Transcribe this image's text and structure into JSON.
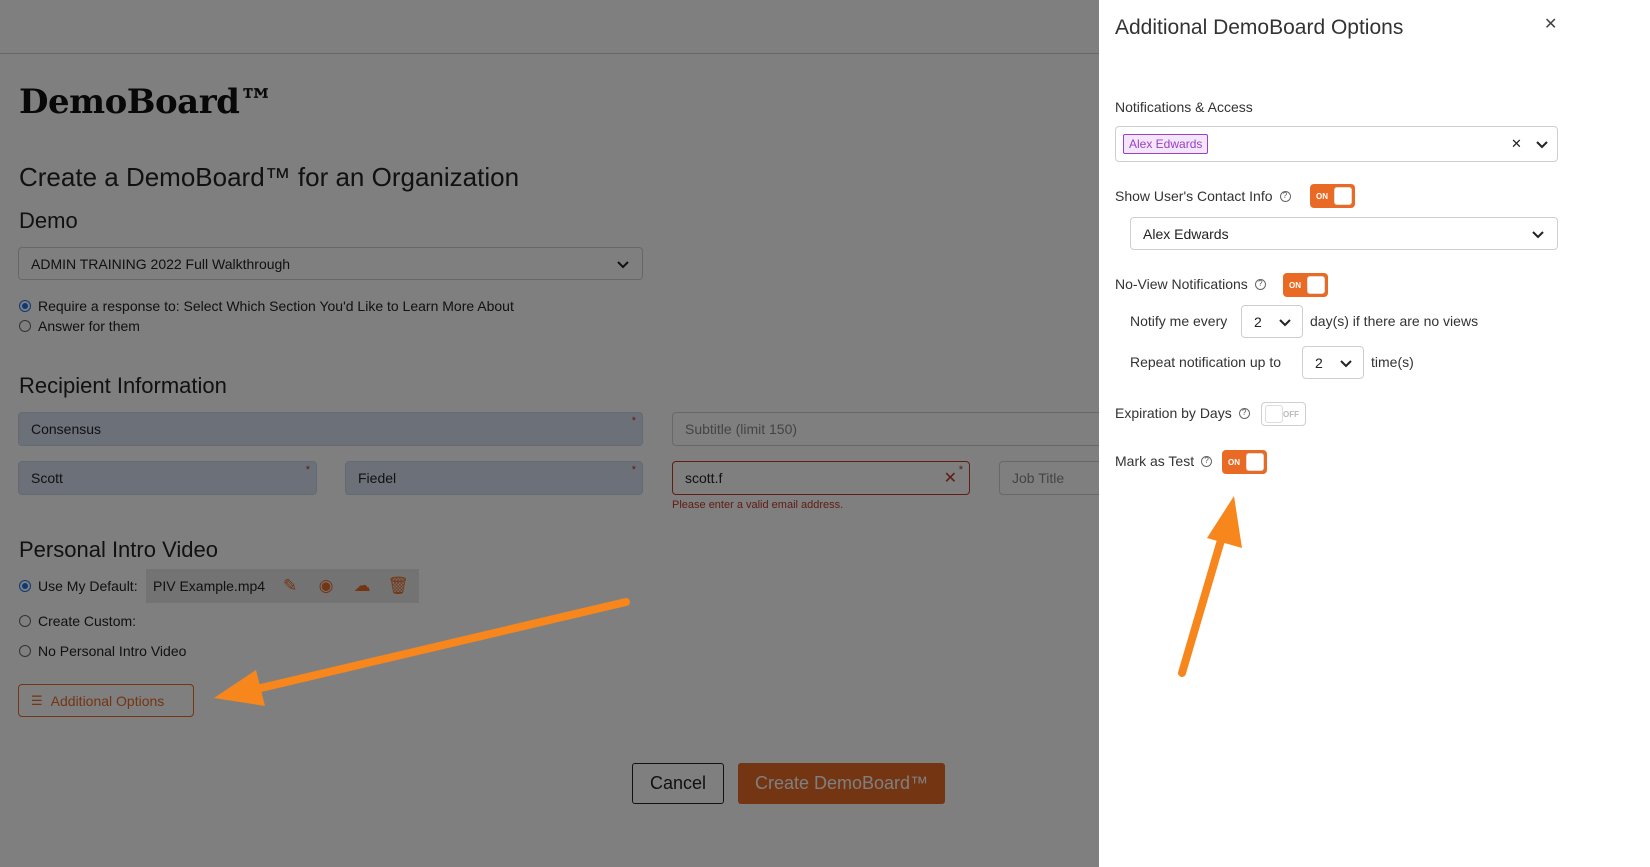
{
  "brand": "DemoBoard™",
  "page": {
    "title": "Create a DemoBoard™ for an Organization",
    "demo_section": "Demo",
    "demo_select": "ADMIN TRAINING 2022 Full Walkthrough",
    "response_options": [
      "Require a response to: Select Which Section You'd Like to Learn More About",
      "Answer for them"
    ],
    "recipient_section": "Recipient Information",
    "organization": "Consensus",
    "subtitle_placeholder": "Subtitle (limit 150)",
    "first_name": "Scott",
    "last_name": "Fiedel",
    "email": "scott.f",
    "email_error": "Please enter a valid email address.",
    "job_title_placeholder": "Job Title",
    "piv_section": "Personal Intro Video",
    "piv_options": {
      "use_default": "Use My Default:",
      "create_custom": "Create Custom:",
      "none": "No Personal Intro Video"
    },
    "piv_file": "PIV Example.mp4",
    "additional_options": "Additional Options",
    "cancel": "Cancel",
    "create": "Create DemoBoard™"
  },
  "panel": {
    "title": "Additional DemoBoard Options",
    "notifications_label": "Notifications & Access",
    "notification_tag": "Alex Edwards",
    "show_contact_label": "Show User's Contact Info",
    "show_contact_toggle": "ON",
    "contact_select": "Alex Edwards",
    "no_view_label": "No-View Notifications",
    "no_view_toggle": "ON",
    "notify_every_label": "Notify me every",
    "notify_every_value": "2",
    "notify_every_suffix": "day(s) if there are no views",
    "repeat_label": "Repeat notification up to",
    "repeat_value": "2",
    "repeat_suffix": "time(s)",
    "expiration_label": "Expiration by Days",
    "expiration_toggle": "OFF",
    "mark_test_label": "Mark as Test",
    "mark_test_toggle": "ON"
  },
  "colors": {
    "accent": "#e86a24",
    "arrow": "#f7861c",
    "error": "#c0392b",
    "tag": "#9b3fc7"
  }
}
